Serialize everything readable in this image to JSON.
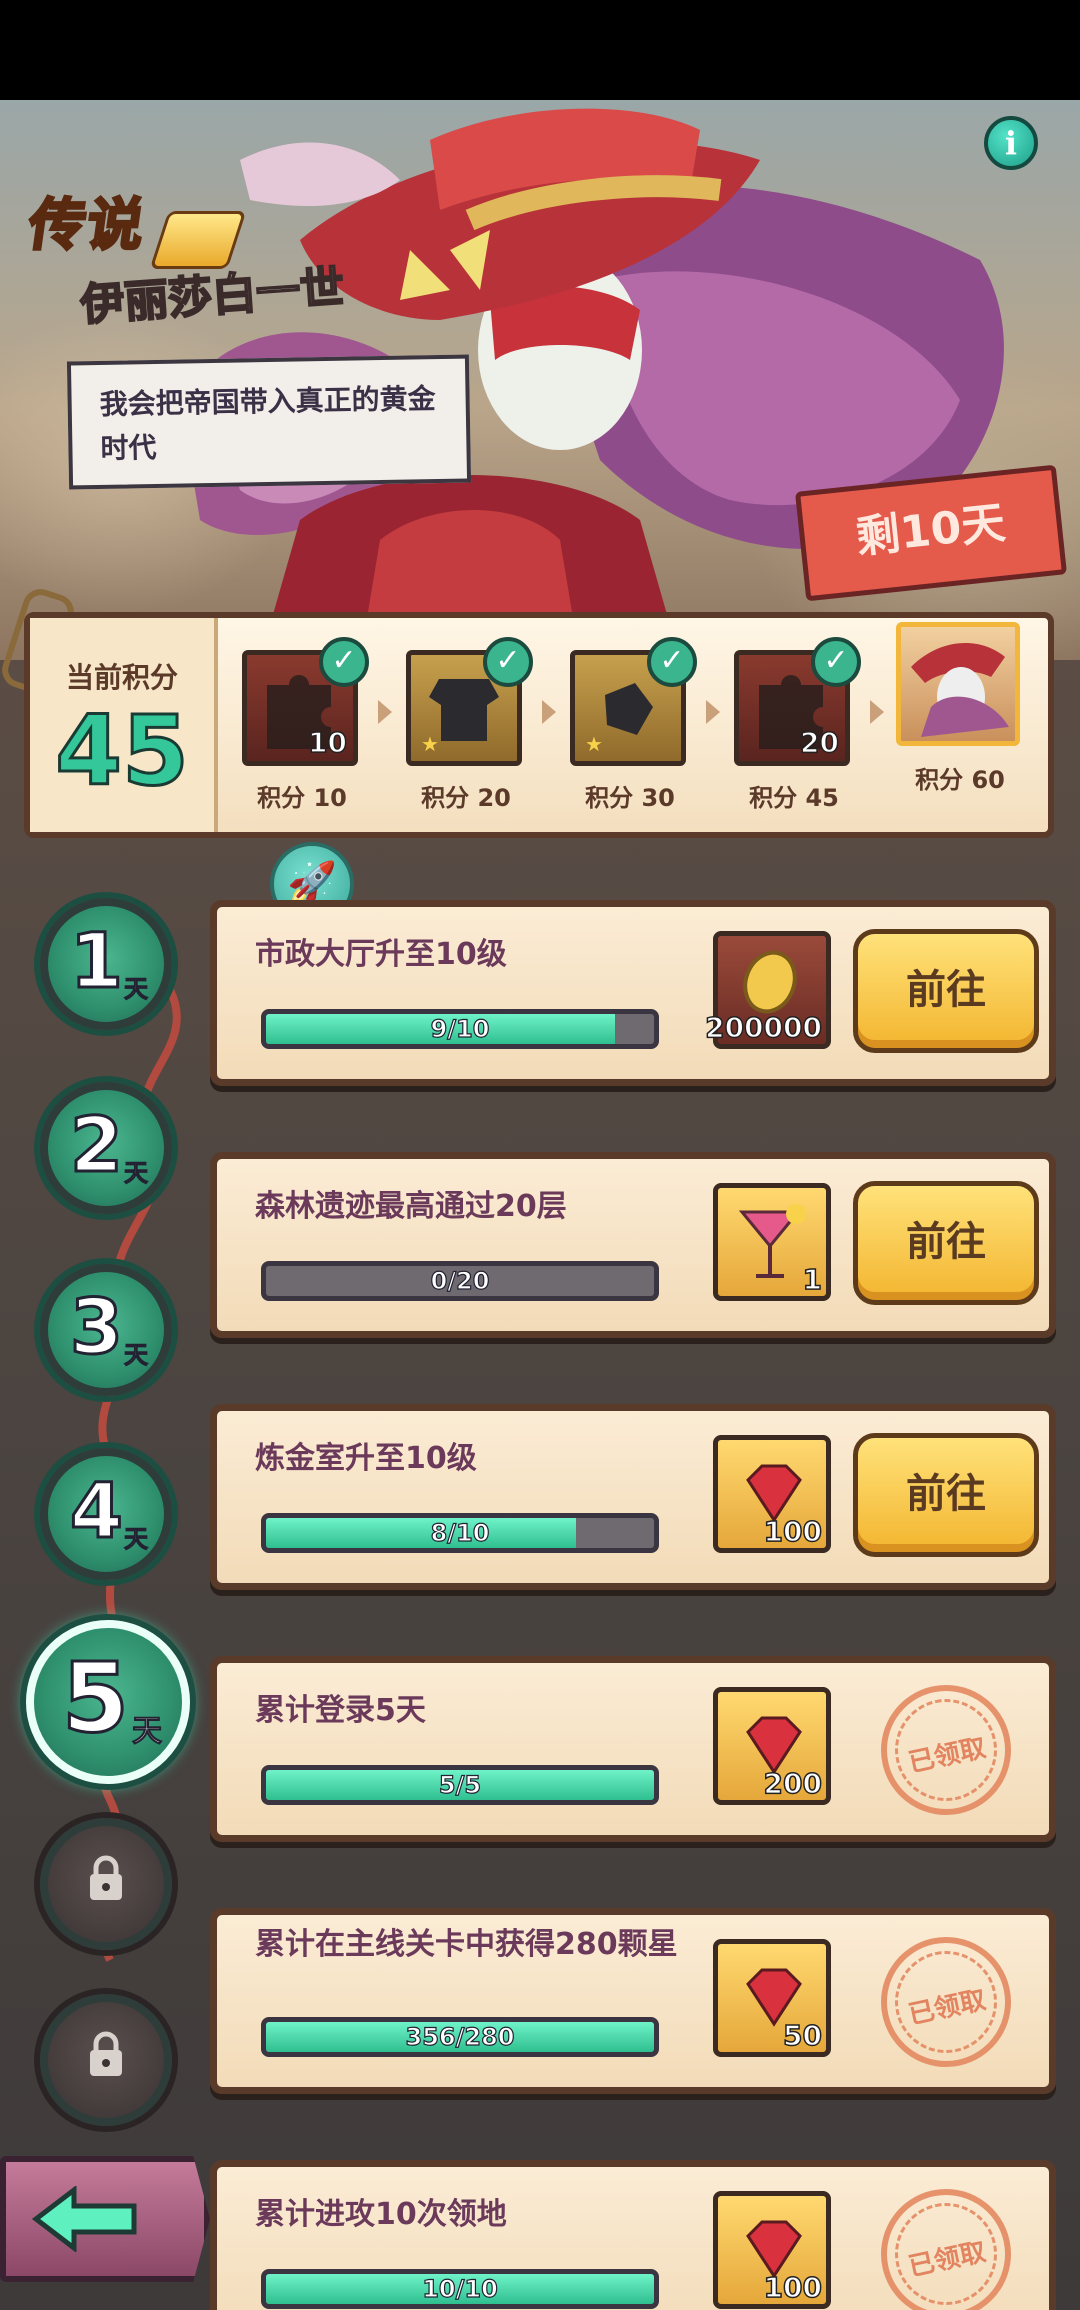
{
  "hero": {
    "rarity": "传说",
    "name": "伊丽莎白一世",
    "quote": "我会把帝国带入真正的黄金时代",
    "days_left": "剩10天",
    "info_icon": "info-icon"
  },
  "points": {
    "current_label": "当前积分",
    "current_value": "45",
    "milestones": [
      {
        "label": "积分 10",
        "count": "10",
        "icon": "puzzle-piece-icon",
        "claimed": true
      },
      {
        "label": "积分 20",
        "count": "",
        "icon": "armor-icon",
        "claimed": true
      },
      {
        "label": "积分 30",
        "count": "",
        "icon": "gauntlet-icon",
        "claimed": true
      },
      {
        "label": "积分 45",
        "count": "20",
        "icon": "puzzle-piece-icon",
        "claimed": true
      },
      {
        "label": "积分 60",
        "count": "",
        "icon": "hero-portrait-icon",
        "claimed": false
      }
    ]
  },
  "days": [
    {
      "num": "1",
      "unit": "天",
      "state": "done"
    },
    {
      "num": "2",
      "unit": "天",
      "state": "done"
    },
    {
      "num": "3",
      "unit": "天",
      "state": "done"
    },
    {
      "num": "4",
      "unit": "天",
      "state": "done"
    },
    {
      "num": "5",
      "unit": "天",
      "state": "active"
    },
    {
      "num": "",
      "unit": "",
      "state": "locked"
    },
    {
      "num": "",
      "unit": "",
      "state": "locked"
    }
  ],
  "tasks": [
    {
      "title": "市政大厅升至10级",
      "progress_text": "9/10",
      "progress": 0.9,
      "reward_icon": "gold-coin-icon",
      "reward_count": "200000",
      "action": "前往"
    },
    {
      "title": "森林遗迹最高通过20层",
      "progress_text": "0/20",
      "progress": 0.0,
      "reward_icon": "cocktail-icon",
      "reward_count": "1",
      "action": "前往"
    },
    {
      "title": "炼金室升至10级",
      "progress_text": "8/10",
      "progress": 0.8,
      "reward_icon": "ruby-gem-icon",
      "reward_count": "100",
      "action": "前往"
    },
    {
      "title": "累计登录5天",
      "progress_text": "5/5",
      "progress": 1.0,
      "reward_icon": "ruby-gem-icon",
      "reward_count": "200",
      "action": "已领取"
    },
    {
      "title": "累计在主线关卡中获得280颗星",
      "progress_text": "356/280",
      "progress": 1.0,
      "reward_icon": "ruby-gem-icon",
      "reward_count": "50",
      "action": "已领取"
    },
    {
      "title": "累计进攻10次领地",
      "progress_text": "10/10",
      "progress": 1.0,
      "reward_icon": "ruby-gem-icon",
      "reward_count": "100",
      "action": "已领取"
    }
  ],
  "colors": {
    "accent_green": "#33c79a",
    "go_button": "#f3b52f",
    "days_left_tag": "#e45a4b"
  }
}
